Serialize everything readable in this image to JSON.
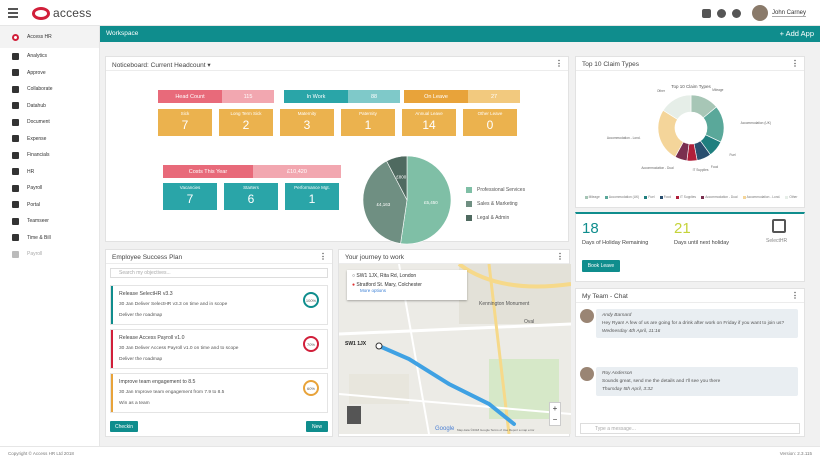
{
  "topbar": {
    "logo_text": "access",
    "user_name": "John Carney"
  },
  "sidebar": {
    "items": [
      {
        "label": "Access HR",
        "icon": "access-logo-icon"
      },
      {
        "label": "Analytics",
        "icon": "analytics-icon"
      },
      {
        "label": "Approve",
        "icon": "check-circle-icon"
      },
      {
        "label": "Collaborate",
        "icon": "people-icon"
      },
      {
        "label": "Datahub",
        "icon": "datahub-icon"
      },
      {
        "label": "Document",
        "icon": "building-icon"
      },
      {
        "label": "Expense",
        "icon": "card-icon"
      },
      {
        "label": "Financials",
        "icon": "financials-icon"
      },
      {
        "label": "HR",
        "icon": "person-icon"
      },
      {
        "label": "Payroll",
        "icon": "payroll-icon"
      },
      {
        "label": "Portal",
        "icon": "search-icon"
      },
      {
        "label": "Teamseer",
        "icon": "calendar-icon"
      },
      {
        "label": "Time & Bill",
        "icon": "clock-icon"
      },
      {
        "label": "Payroll",
        "icon": "payroll-icon"
      }
    ]
  },
  "workspace": {
    "title": "Workspace",
    "add_app": "+ Add App"
  },
  "noticeboard": {
    "title": "Noticeboard: Current Headcount ▾",
    "head_count": {
      "label": "Head Count",
      "value": "115"
    },
    "in_work": {
      "label": "In Work",
      "value": "88"
    },
    "on_leave": {
      "label": "On Leave",
      "value": "27"
    },
    "leave_tiles": [
      {
        "label": "Sick",
        "value": "7"
      },
      {
        "label": "Long Term Sick",
        "value": "2"
      },
      {
        "label": "Maternity",
        "value": "3"
      },
      {
        "label": "Paternity",
        "value": "1"
      },
      {
        "label": "Annual Leave",
        "value": "14"
      },
      {
        "label": "Other Leave",
        "value": "0"
      }
    ],
    "costs": {
      "label": "Costs This Year",
      "value": "£10,420"
    },
    "move_tiles": [
      {
        "label": "Vacancies",
        "value": "7"
      },
      {
        "label": "Starters",
        "value": "6"
      },
      {
        "label": "Performance Mgt.",
        "value": "1"
      }
    ],
    "pie": {
      "slices": [
        {
          "name": "Professional Services",
          "label": "£5,450",
          "value": 5450,
          "color": "#7fbfa6"
        },
        {
          "name": "Sales & Marketing",
          "label": "£4,163",
          "value": 4163,
          "color": "#6f8f82"
        },
        {
          "name": "Legal & Admin",
          "label": "£800",
          "value": 800,
          "color": "#4f6a60"
        }
      ]
    }
  },
  "claims": {
    "title": "Top 10 Claim Types",
    "chart_title": "Top 10 Claim Types",
    "chart_data": {
      "type": "pie",
      "title": "Top 10 Claim Types",
      "slices": [
        {
          "name": "Mileage",
          "value": 14,
          "color": "#a7c6b6"
        },
        {
          "name": "Accommodation (UK)",
          "value": 18,
          "color": "#5aa89a"
        },
        {
          "name": "Fuel",
          "value": 8,
          "color": "#1f7f7f"
        },
        {
          "name": "Food",
          "value": 7,
          "color": "#2a4f6f"
        },
        {
          "name": "IT Supplies",
          "value": 5,
          "color": "#b01f3a"
        },
        {
          "name": "Accommodation - Dual",
          "value": 6,
          "color": "#7a2f4f"
        },
        {
          "name": "Accommodation - Lond.",
          "value": 26,
          "color": "#f4d59a"
        },
        {
          "name": "Other",
          "value": 16,
          "color": "#e6eee8"
        }
      ]
    }
  },
  "holiday": {
    "remaining_value": "18",
    "remaining_label": "Days of Holiday Remaining",
    "next_value": "21",
    "next_label": "Days until next holiday",
    "app_label": "SelectHR",
    "button": "Book Leave"
  },
  "esp": {
    "title": "Employee Success Plan",
    "search_placeholder": "Search my objectives...",
    "goals": [
      {
        "title": "Release SelectHR v3.3",
        "detail": "30 Jan  Deliver SelectHR v3.3 on time and in scope",
        "sub": "Deliver the roadmap",
        "pct": "100%",
        "color": "#0f8d8d"
      },
      {
        "title": "Release Access Payroll v1.0",
        "detail": "30 Jan  Deliver Access Payroll v1.0 on time and to scope",
        "sub": "Deliver the roadmap",
        "pct": "70%",
        "color": "#d11f3a"
      },
      {
        "title": "Improve team engagement to 8.5",
        "detail": "30 Jan  Improve team engagement from 7.9 to 8.5",
        "sub": "Win as a team",
        "pct": "60%",
        "color": "#e8a33a"
      }
    ],
    "checkin": "Checkin",
    "new": "New"
  },
  "journey": {
    "title": "Your journey to work",
    "from": "SW1 1JX, Rita Rd, London",
    "to": "Stratford St. Mary, Colchester",
    "more": "More options",
    "labels": {
      "kennington": "Kennington Monument",
      "oval": "Oval",
      "sw1": "SW1 1JX",
      "footer": "Map data ©2018 Google   Terms of Use   Report a map error",
      "google": "Google"
    }
  },
  "chat": {
    "title": "My Team - Chat",
    "messages": [
      {
        "name": "Andy Barnard",
        "text": "Hey Ryan! A few of us are going for a drink after work on Friday if you want to join us?",
        "date": "Wednesday 4th April, 11:16"
      },
      {
        "name": "Roy Anderson",
        "text": "Sounds great, send me the details and I'll see you there",
        "date": "Thursday 5th April, 3:32"
      }
    ],
    "placeholder": "Type a message..."
  },
  "footer": {
    "copyright": "Copyright © Access HR Ltd 2018",
    "version": "Version: 2.3.115"
  }
}
